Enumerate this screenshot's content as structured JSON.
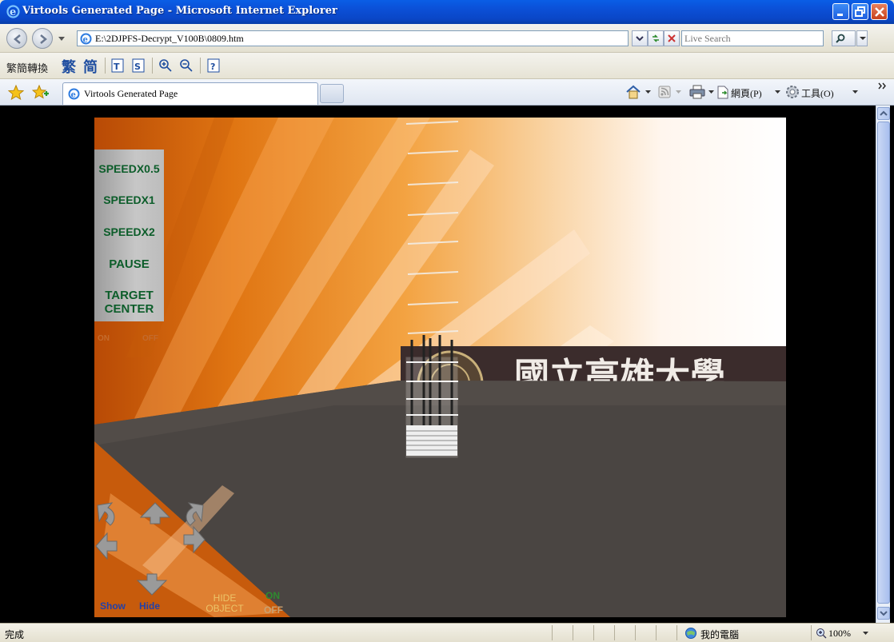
{
  "window": {
    "title": "Virtools Generated Page - Microsoft Internet Explorer"
  },
  "address": {
    "url": "E:\\2DJPFS-Decrypt_V100B\\0809.htm"
  },
  "search": {
    "placeholder": "Live Search"
  },
  "cn_toolbar": {
    "label": "繁簡轉換",
    "trad": "繁",
    "simp": "简"
  },
  "tabs": [
    {
      "label": "Virtools Generated Page"
    }
  ],
  "commands": {
    "page": "網頁(P)",
    "tools": "工具(O)"
  },
  "scene": {
    "banner_text": "國立高雄大學",
    "menu": [
      "SPEEDX0.5",
      "SPEEDX1",
      "SPEEDX2",
      "PAUSE",
      "TARGET CENTER"
    ],
    "on_label": "ON",
    "off_label": "OFF",
    "show_label": "Show",
    "hide_label": "Hide",
    "hide_object_label": "HIDE OBJECT",
    "on2_label": "ON",
    "off2_label": "OFF"
  },
  "status": {
    "text": "完成",
    "zone": "我的電腦",
    "zoom": "100%"
  },
  "colors": {
    "menu_text": "#0c5d2a",
    "titlebar": "#0a5ee6",
    "floor": "#4a4542"
  }
}
